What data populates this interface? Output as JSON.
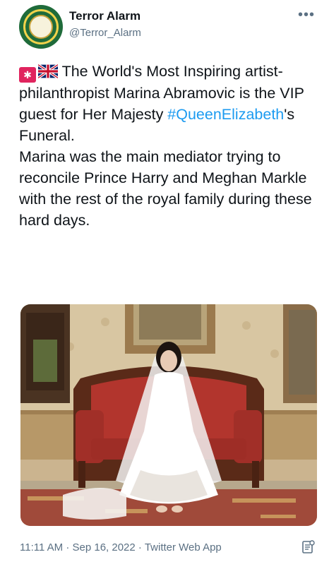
{
  "header": {
    "display_name": "Terror Alarm",
    "handle": "@Terror_Alarm",
    "avatar_icon": "terror-alarm-logo",
    "more_icon": "more-dots-icon"
  },
  "tweet": {
    "emojis": [
      "police-light-icon",
      "uk-flag-icon"
    ],
    "text_part1": "The World's Most Inspiring artist-philanthropist Marina Abramovic is the VIP guest for Her Majesty ",
    "hashtag": "#QueenElizabeth",
    "text_part2": "'s Funeral.",
    "paragraph2": "Marina was the main mediator trying to reconcile Prince Harry and Meghan Markle with the rest of the royal family during these hard days."
  },
  "media": {
    "icon": "photo-woman-in-white-gown-on-red-sofa"
  },
  "footer": {
    "time": "11:11 AM",
    "separator": "·",
    "date": "Sep 16, 2022",
    "client": "Twitter Web App",
    "analytics_icon": "analytics-icon"
  },
  "colors": {
    "link": "#1d9bf0",
    "muted": "#5b7083",
    "sofa": "#b2352d"
  }
}
